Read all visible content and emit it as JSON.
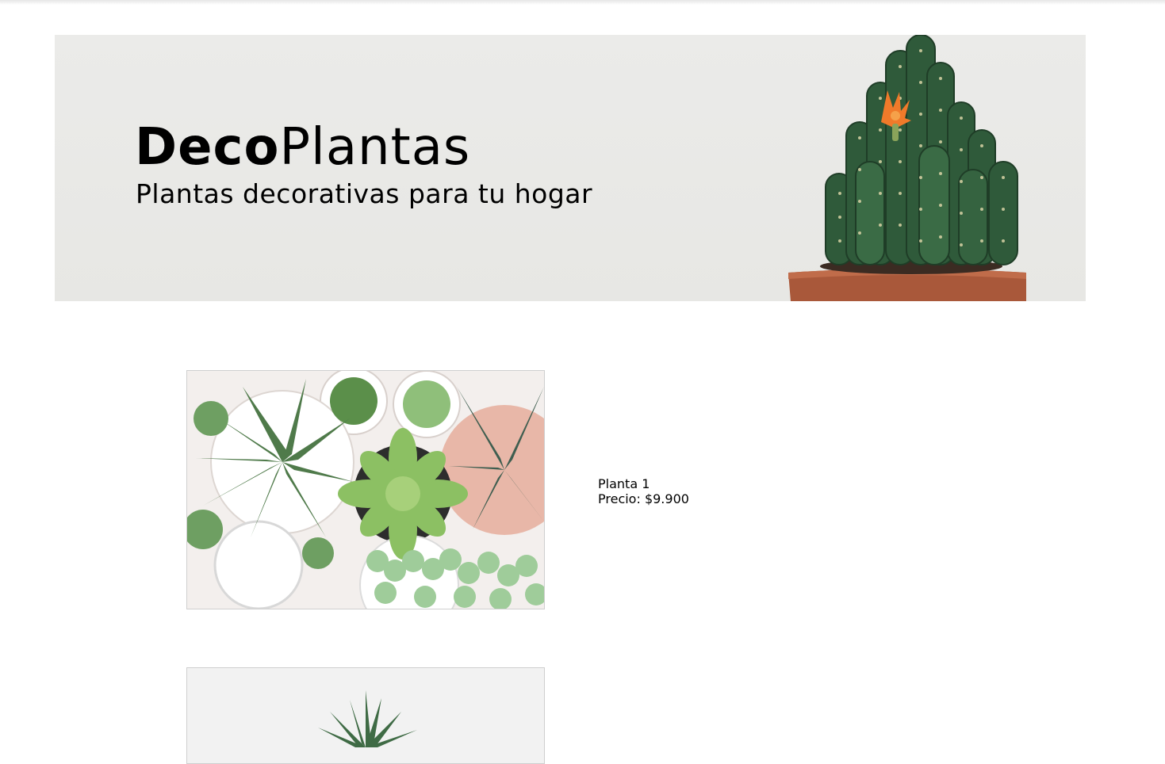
{
  "brand": {
    "bold": "Deco",
    "regular": "Plantas"
  },
  "tagline": "Plantas decorativas para tu hogar",
  "products": [
    {
      "name": "Planta 1",
      "price_label": "Precio: $9.900",
      "image_icon": "succulents-photo-icon"
    },
    {
      "image_icon": "aloe-photo-icon"
    }
  ],
  "colors": {
    "hero_background": "#e9e9e6",
    "cactus_green": "#2f5a3a",
    "pot_terracotta": "#a9583a",
    "flower_orange": "#f07a2a"
  }
}
